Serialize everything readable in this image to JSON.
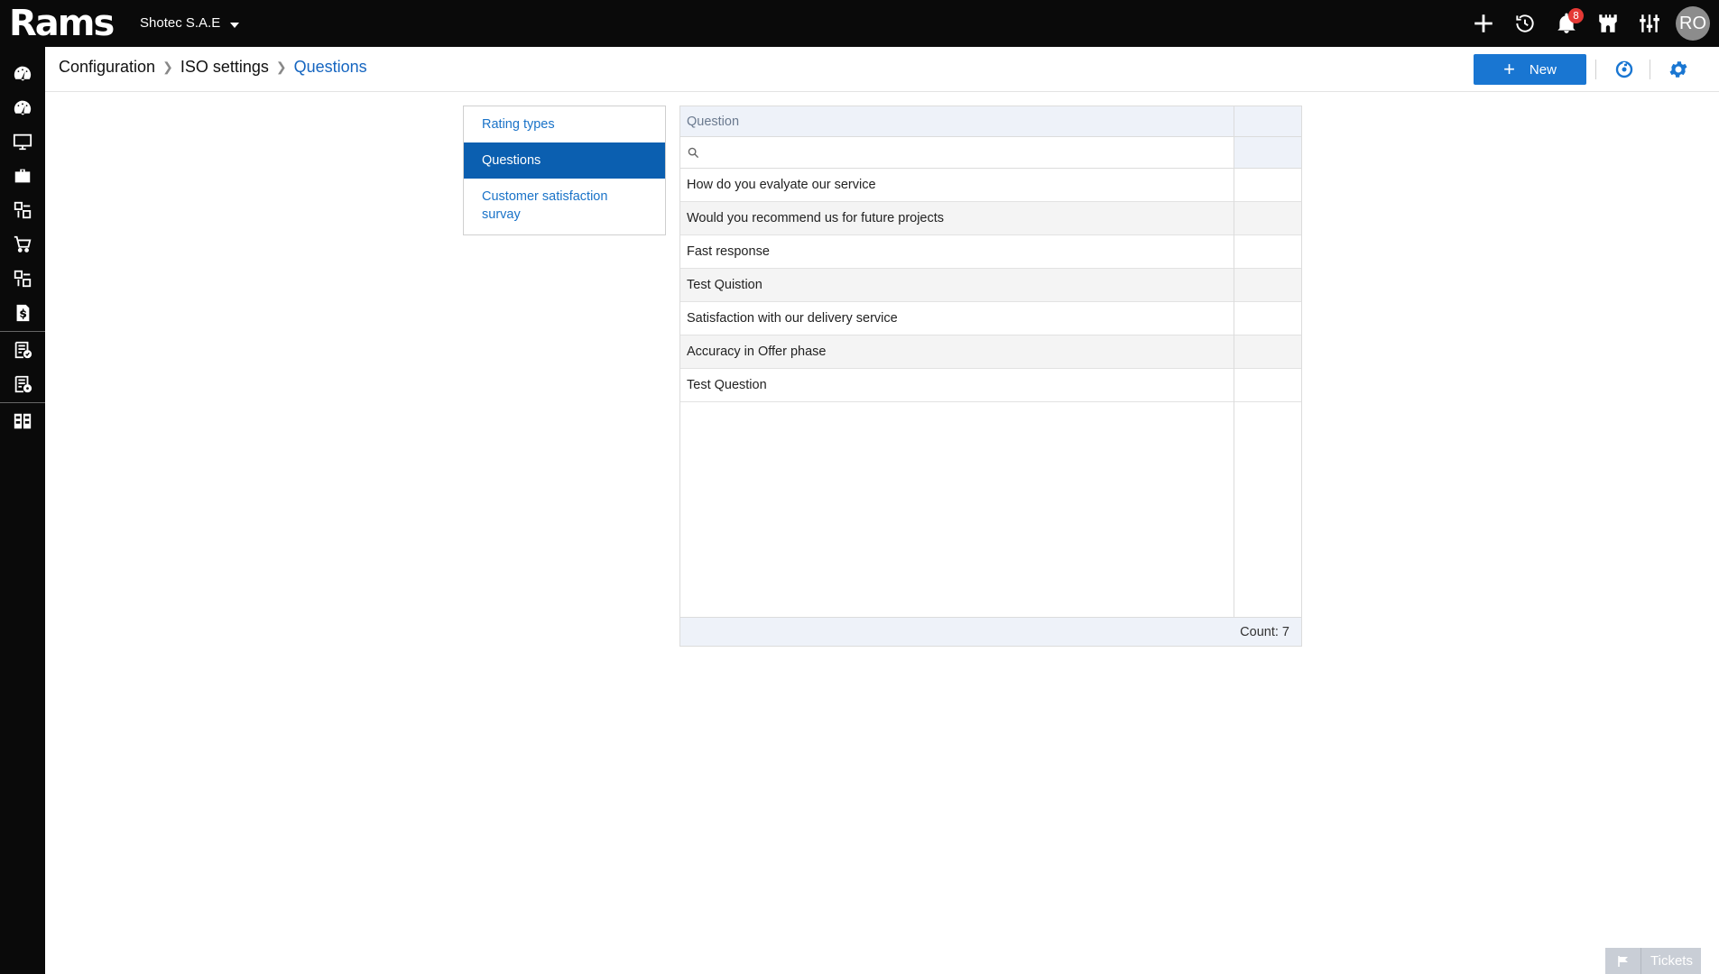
{
  "app": {
    "logo_text": "Rams",
    "company": "Shotec S.A.E"
  },
  "topbar": {
    "notification_count": "8",
    "avatar_initials": "RO"
  },
  "breadcrumb": {
    "items": [
      "Configuration",
      "ISO settings",
      "Questions"
    ]
  },
  "header": {
    "new_label": "New"
  },
  "nav": {
    "items": [
      "Rating types",
      "Questions",
      "Customer satisfaction survay"
    ],
    "active": "Questions"
  },
  "grid": {
    "column_header": "Question",
    "filter_placeholder": "",
    "rows": [
      "How do you evalyate our service",
      "Would you recommend us for future projects",
      "Fast response",
      "Test Quistion",
      "Satisfaction with our delivery service",
      "Accuracy in Offer phase",
      "Test Question"
    ],
    "count_label": "Count: 7"
  },
  "tickets": {
    "label": "Tickets"
  },
  "colors": {
    "accent": "#1976d2",
    "active_nav": "#0b5fb0",
    "link": "#1a73c8",
    "topbar": "#0a0a0a",
    "badge": "#e53935"
  }
}
